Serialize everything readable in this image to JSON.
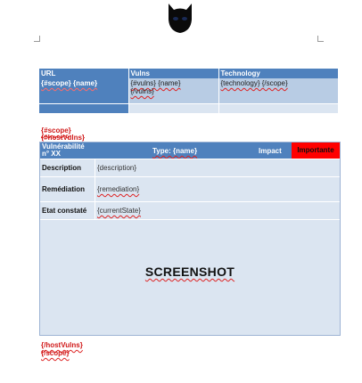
{
  "header": {
    "logo_icon": "black-cat-mask-logo"
  },
  "summary_table": {
    "columns": [
      "URL",
      "Vulns",
      "Technology"
    ],
    "row": {
      "url": "{#scope} {name}",
      "vulns": "{#vulns} {name}",
      "vulns_end": "{/vulns}",
      "technology": "{technology} {/scope}"
    }
  },
  "loop_open": {
    "scope": "{#scope}",
    "hostvulns": "{#hostVulns}"
  },
  "vuln_card": {
    "title_line1": "Vulnérabilité",
    "title_line2": "n° XX",
    "type": "Type: {name}",
    "impact": "Impact",
    "badge": "Importante",
    "badge_color": "#ff0000",
    "rows": [
      {
        "label": "Description",
        "value": "{description}"
      },
      {
        "label": "Remédiation",
        "value": "{remediation}"
      },
      {
        "label": "Etat constaté",
        "value": "{currentState}"
      }
    ],
    "screenshot": "SCREENSHOT"
  },
  "loop_close": {
    "hostvulns": "{/hostVulns}",
    "scope": "{/scope}"
  },
  "colors": {
    "header_blue": "#4f81bd",
    "light_blue": "#b8cce4",
    "pale_blue": "#dbe5f1",
    "tag_red": "#d01818"
  }
}
